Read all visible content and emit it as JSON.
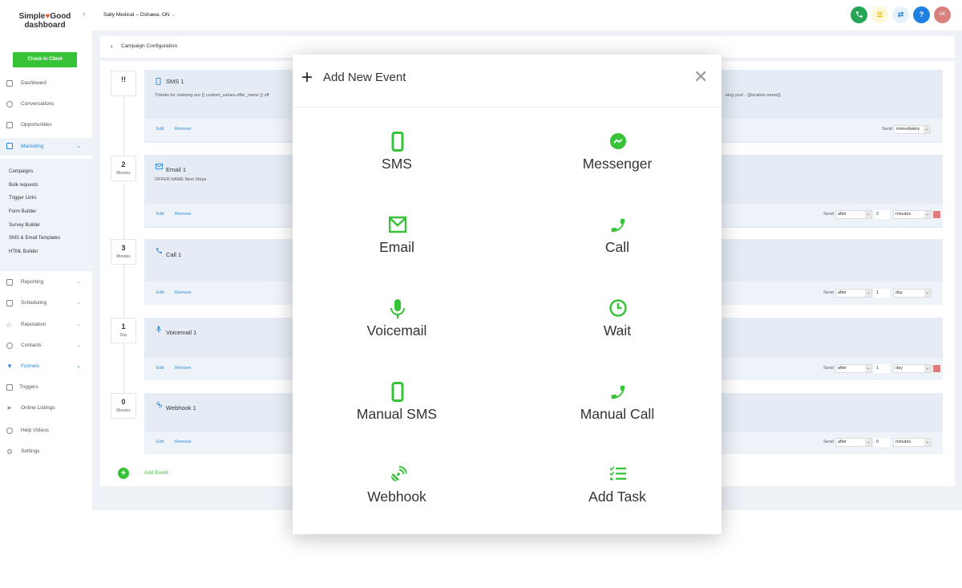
{
  "sidebar": {
    "logo_line1_a": "Simple",
    "logo_line1_b": "Good",
    "logo_line2": "dashboard",
    "collapse": "‹",
    "checkin": "Check In Client",
    "nav": [
      {
        "label": "Dashboard"
      },
      {
        "label": "Conversations"
      },
      {
        "label": "Opportunities"
      },
      {
        "label": "Marketing"
      },
      {
        "label": "Reporting"
      },
      {
        "label": "Scheduling"
      },
      {
        "label": "Reputation"
      },
      {
        "label": "Contacts"
      },
      {
        "label": "Funnels"
      },
      {
        "label": "Triggers"
      },
      {
        "label": "Online Listings"
      },
      {
        "label": "Help Videos"
      },
      {
        "label": "Settings"
      }
    ],
    "submenu": [
      "Campaigns",
      "Bulk requests",
      "Trigger Links",
      "Form Builder",
      "Survey Builder",
      "SMS & Email Templates",
      "HTML Builder"
    ]
  },
  "topbar": {
    "location": "Sally Medical – Oshawa, ON",
    "avatar": "AK",
    "help": "?"
  },
  "config": {
    "title": "Campaign Configuration"
  },
  "events": [
    {
      "num": "!!",
      "unit": "",
      "title": "SMS 1",
      "body_left": "Thanks for claiming our {{ custom_values.offer_name }} off",
      "body_right": "eing you! - {{location.name}}",
      "edit": "Edit",
      "remove": "Remove",
      "send": "Send",
      "when": "immediately"
    },
    {
      "num": "2",
      "unit": "Minutes",
      "title": "Email 1",
      "body_left": "OFFER NAME Next Steps",
      "edit": "Edit",
      "remove": "Remove",
      "send": "Send",
      "when": "after",
      "amount": "2",
      "period": "minutes"
    },
    {
      "num": "3",
      "unit": "Minutes",
      "title": "Call 1",
      "edit": "Edit",
      "remove": "Remove",
      "send": "Send",
      "when": "after",
      "amount": "1",
      "period": "day"
    },
    {
      "num": "1",
      "unit": "Day",
      "title": "Voicemail 1",
      "edit": "Edit",
      "remove": "Remove",
      "send": "Send",
      "when": "after",
      "amount": "1",
      "period": "day"
    },
    {
      "num": "0",
      "unit": "Minutes",
      "title": "Webhook 1",
      "edit": "Edit",
      "remove": "Remove",
      "send": "Send",
      "when": "after",
      "amount": "0",
      "period": "minutes"
    }
  ],
  "add_event": "Add Event",
  "modal": {
    "title": "Add New Event",
    "options": [
      {
        "label": "SMS",
        "icon": "phone-device-icon"
      },
      {
        "label": "Messenger",
        "icon": "messenger-icon"
      },
      {
        "label": "Email",
        "icon": "envelope-icon"
      },
      {
        "label": "Call",
        "icon": "phone-handset-icon"
      },
      {
        "label": "Voicemail",
        "icon": "microphone-icon"
      },
      {
        "label": "Wait",
        "icon": "clock-icon"
      },
      {
        "label": "Manual SMS",
        "icon": "phone-device-icon"
      },
      {
        "label": "Manual Call",
        "icon": "phone-handset-icon"
      },
      {
        "label": "Webhook",
        "icon": "satellite-icon"
      },
      {
        "label": "Add Task",
        "icon": "checklist-icon"
      }
    ]
  },
  "colors": {
    "accent_green": "#37c337",
    "accent_blue": "#2e8bd8",
    "card_bg": "#e5ecf5"
  }
}
